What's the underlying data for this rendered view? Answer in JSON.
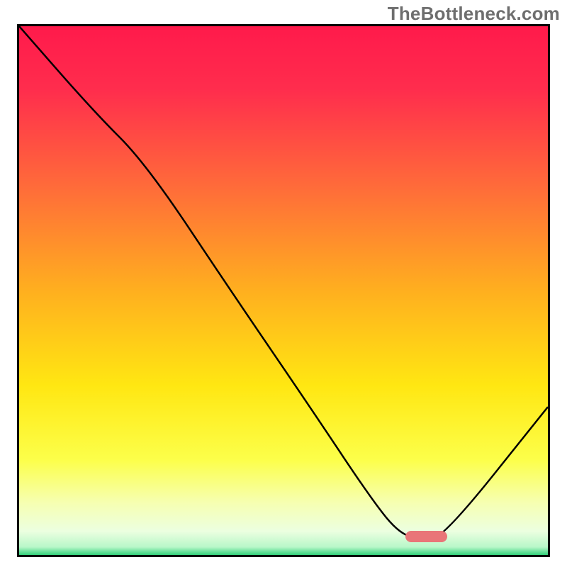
{
  "watermark": {
    "text": "TheBottleneck.com"
  },
  "chart_data": {
    "type": "line",
    "title": "",
    "xlabel": "",
    "ylabel": "",
    "xlim": [
      0,
      100
    ],
    "ylim": [
      0,
      100
    ],
    "grid": false,
    "legend": false,
    "gradient_stops": [
      {
        "offset": 0,
        "color": "#ff1a4b"
      },
      {
        "offset": 0.12,
        "color": "#ff2d4d"
      },
      {
        "offset": 0.3,
        "color": "#ff6a3a"
      },
      {
        "offset": 0.5,
        "color": "#ffaf1f"
      },
      {
        "offset": 0.68,
        "color": "#ffe712"
      },
      {
        "offset": 0.82,
        "color": "#fcff4a"
      },
      {
        "offset": 0.9,
        "color": "#f6ffb0"
      },
      {
        "offset": 0.955,
        "color": "#ecffe0"
      },
      {
        "offset": 0.985,
        "color": "#b8f7c9"
      },
      {
        "offset": 1.0,
        "color": "#33d17a"
      }
    ],
    "series": [
      {
        "name": "bottleneck-curve",
        "x": [
          0,
          14,
          24,
          40,
          55,
          67,
          72,
          76,
          80,
          100
        ],
        "y": [
          100,
          84,
          74,
          50,
          28,
          10,
          4,
          3,
          3,
          28
        ]
      }
    ],
    "marker": {
      "name": "optimal-range-marker",
      "x_start": 73,
      "x_end": 81,
      "y": 3.5,
      "thickness_pct": 2.2,
      "color": "#e97578"
    }
  }
}
